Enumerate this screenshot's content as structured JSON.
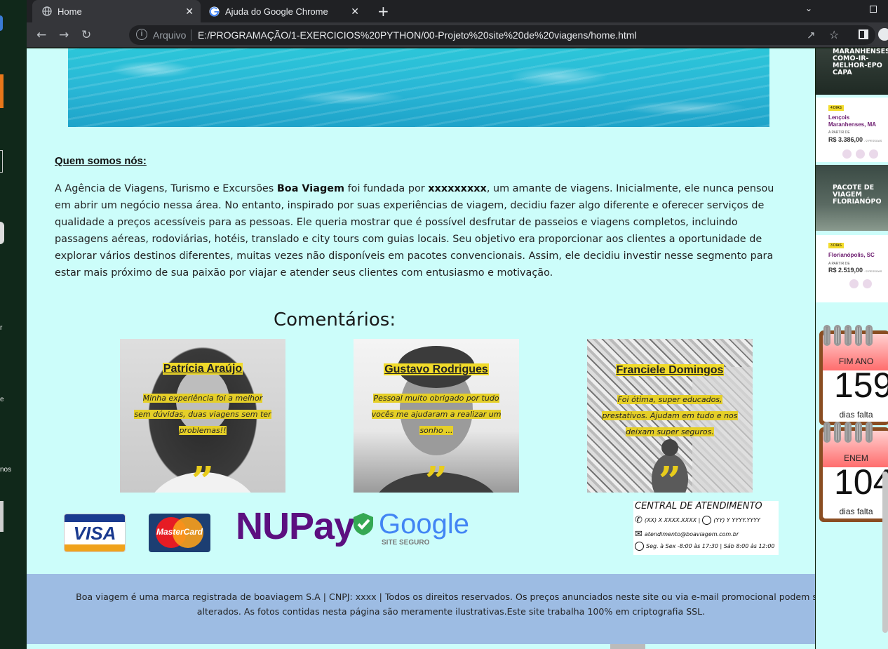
{
  "tabs": [
    {
      "title": "Home",
      "icon": "globe-icon",
      "close": "✕"
    },
    {
      "title": "Ajuda do Google Chrome",
      "icon": "google-icon",
      "close": "✕"
    }
  ],
  "toolbar": {
    "security_label": "Arquivo",
    "url": "E:/PROGRAMAÇÃO/1-EXERCICIOS%20PYTHON/00-Projeto%20site%20de%20viagens/home.html"
  },
  "desktop": {
    "labels": [
      "r",
      "e",
      "nos"
    ]
  },
  "about": {
    "heading": "Quem somos nós:",
    "p1": "A Agência de Viagens, Turismo e Excursões ",
    "brand": "Boa Viagem",
    "p2": " foi fundada por ",
    "founder": "xxxxxxxxx",
    "p3": ", um amante de viagens. Inicialmente, ele nunca pensou em abrir um negócio nessa área. No entanto, inspirado por suas experiências de viagem, decidiu fazer algo diferente e oferecer serviços de qualidade a preços acessíveis para as pessoas. Ele queria mostrar que é possível desfrutar de passeios e viagens completos, incluindo passagens aéreas, rodoviárias, hotéis, translado e city tours com guias locais. Seu objetivo era proporcionar aos clientes a oportunidade de explorar vários destinos diferentes, muitas vezes não disponíveis em pacotes convencionais. Assim, ele decidiu investir nesse segmento para estar mais próximo de sua paixão por viajar e atender seus clientes com entusiasmo e motivação."
  },
  "comments": {
    "heading": "Comentários:",
    "items": [
      {
        "name": "Patrícia Araújo",
        "text": "Minha experiência foi a melhor sem dúvidas, duas viagens sem ter problemas!!"
      },
      {
        "name": "Gustavo Rodrigues",
        "text": "Pessoal muito obrigado por tudo vocês me ajudaram a realizar um sonho ..."
      },
      {
        "name": "Franciele Domingos",
        "text": "Foi ótima, super educados, prestativos. Ajudam em tudo e nos deixam super seguros."
      }
    ]
  },
  "payments": {
    "visa": "VISA",
    "mastercard": "MasterCard",
    "nupay": "NUPay",
    "google": "Google",
    "google_sub": "SITE SEGURO"
  },
  "central": {
    "title": "CENTRAL DE ATENDIMENTO",
    "phone": "(XX) X XXXX.XXXX |",
    "whatsapp": "(YY) Y YYYY.YYYY",
    "email": "atendimento@boaviagem.com.br",
    "hours": "Seg. à Sex -8:00 às 17:30 | Sáb 8:00 às 12:00"
  },
  "footer": {
    "text": "Boa viagem é uma marca registrada de boaviagem S.A | CNPJ: xxxx | Todos os direitos reservados. Os preços anunciados neste site ou via e-mail promocional podem ser alterados. As fotos contidas nesta página são meramente ilustrativas.Este site trabalha 100% em criptografia SSL."
  },
  "promos": [
    {
      "banner": "MARANHENSES COMO-IR- MELHOR-EPO CAPA",
      "badge": "4 DIAS",
      "destination": "Lençois Maranhenses, MA",
      "from": "A PARTIR DE",
      "price": "R$ 3.386,00",
      "per": "/ 2 PESSOAS"
    },
    {
      "banner": "PACOTE DE VIAGEM FLORIANÓPO",
      "badge": "3 DIAS",
      "destination": "Florianópolis, SC",
      "from": "A PARTIR DE",
      "price": "R$ 2.519,00",
      "per": "/ 2 PESSOAS"
    }
  ],
  "countdowns": [
    {
      "label": "FIM ANO",
      "number": "159",
      "caption": "dias falta"
    },
    {
      "label": "ENEM",
      "number": "104",
      "caption": "dias falta"
    }
  ]
}
